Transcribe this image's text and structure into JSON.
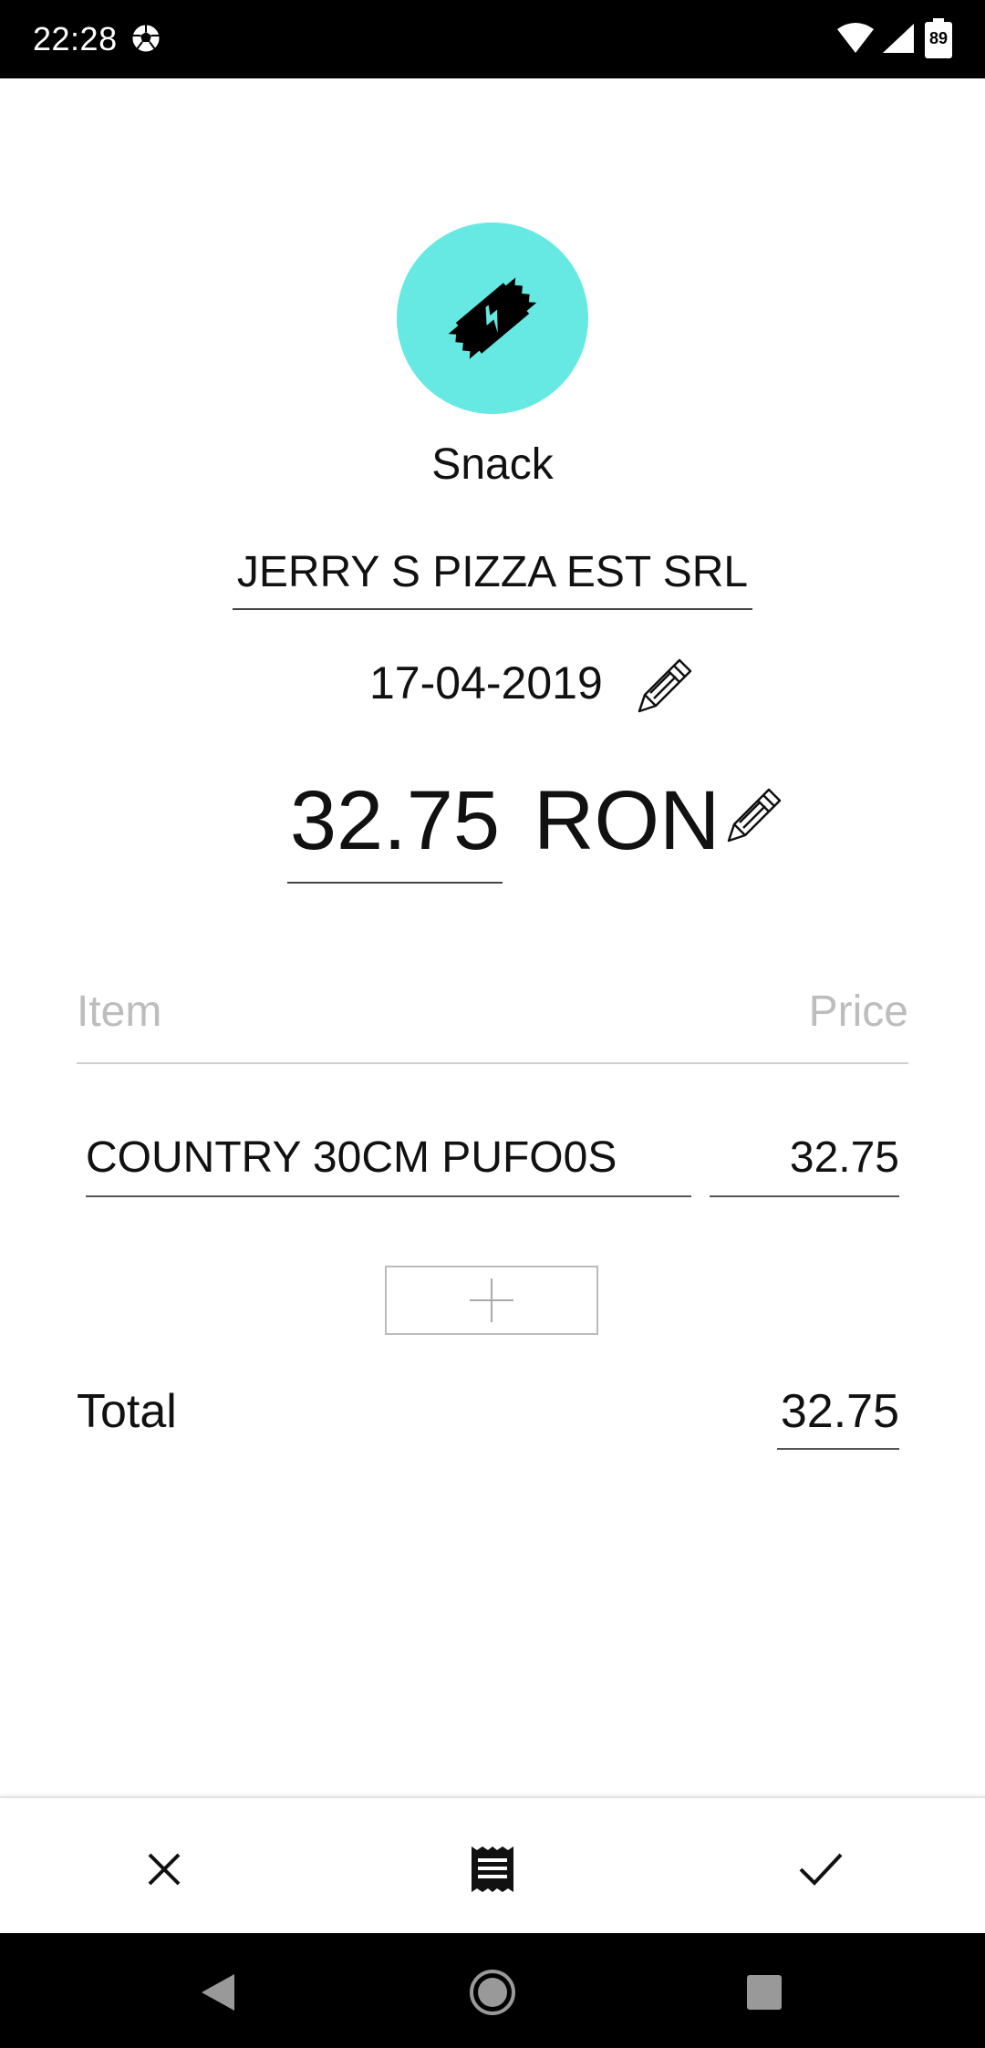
{
  "status_bar": {
    "time": "22:28",
    "battery_level": "89",
    "icons": [
      "soccer-ball-icon",
      "wifi-icon",
      "signal-icon",
      "battery-icon"
    ]
  },
  "category": {
    "label": "Snack",
    "icon": "snack-bar-icon",
    "color": "#66e9e2"
  },
  "receipt": {
    "merchant": "JERRY S PIZZA EST SRL",
    "date": "17-04-2019",
    "amount": "32.75",
    "currency": "RON"
  },
  "items_table": {
    "columns": {
      "item": "Item",
      "price": "Price"
    },
    "rows": [
      {
        "name": "COUNTRY 30CM PUFO0S",
        "price": "32.75"
      }
    ]
  },
  "total": {
    "label": "Total",
    "value": "32.75"
  },
  "toolbar": {
    "icons": [
      "close-icon",
      "receipt-icon",
      "checkmark-icon"
    ]
  },
  "nav": {
    "icons": [
      "back-icon",
      "home-icon",
      "recents-icon"
    ]
  }
}
